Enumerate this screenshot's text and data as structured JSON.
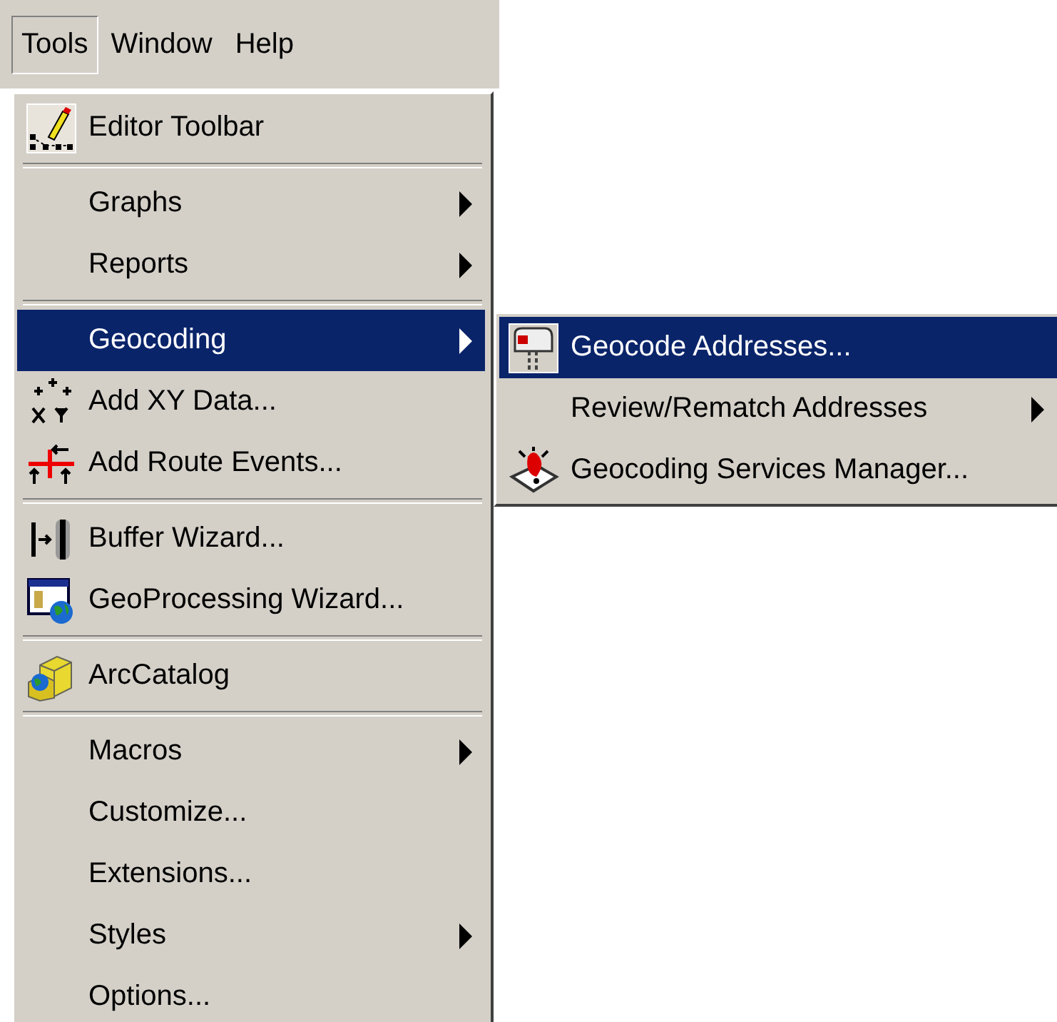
{
  "menu_bar": [
    {
      "label": "Tools",
      "selected": true
    },
    {
      "label": "Window",
      "selected": false
    },
    {
      "label": "Help",
      "selected": false
    }
  ],
  "menu": {
    "groups": [
      [
        {
          "label": "Editor Toolbar",
          "submenu": false,
          "selected": false
        }
      ],
      [
        {
          "label": "Graphs",
          "submenu": true,
          "selected": false
        },
        {
          "label": "Reports",
          "submenu": true,
          "selected": false
        }
      ],
      [
        {
          "label": "Geocoding",
          "submenu": true,
          "selected": true
        },
        {
          "label": "Add XY Data...",
          "submenu": false,
          "selected": false
        },
        {
          "label": "Add Route Events...",
          "submenu": false,
          "selected": false
        }
      ],
      [
        {
          "label": "Buffer Wizard...",
          "submenu": false,
          "selected": false
        },
        {
          "label": "GeoProcessing Wizard...",
          "submenu": false,
          "selected": false
        }
      ],
      [
        {
          "label": "ArcCatalog",
          "submenu": false,
          "selected": false
        }
      ],
      [
        {
          "label": "Macros",
          "submenu": true,
          "selected": false
        },
        {
          "label": "Customize...",
          "submenu": false,
          "selected": false
        },
        {
          "label": "Extensions...",
          "submenu": false,
          "selected": false
        },
        {
          "label": "Styles",
          "submenu": true,
          "selected": false
        },
        {
          "label": "Options...",
          "submenu": false,
          "selected": false
        }
      ]
    ]
  },
  "submenu": {
    "items": [
      {
        "label": "Geocode Addresses...",
        "submenu": false,
        "selected": true
      },
      {
        "label": "Review/Rematch Addresses",
        "submenu": true,
        "selected": false
      },
      {
        "label": "Geocoding Services Manager...",
        "submenu": false,
        "selected": false
      }
    ]
  }
}
